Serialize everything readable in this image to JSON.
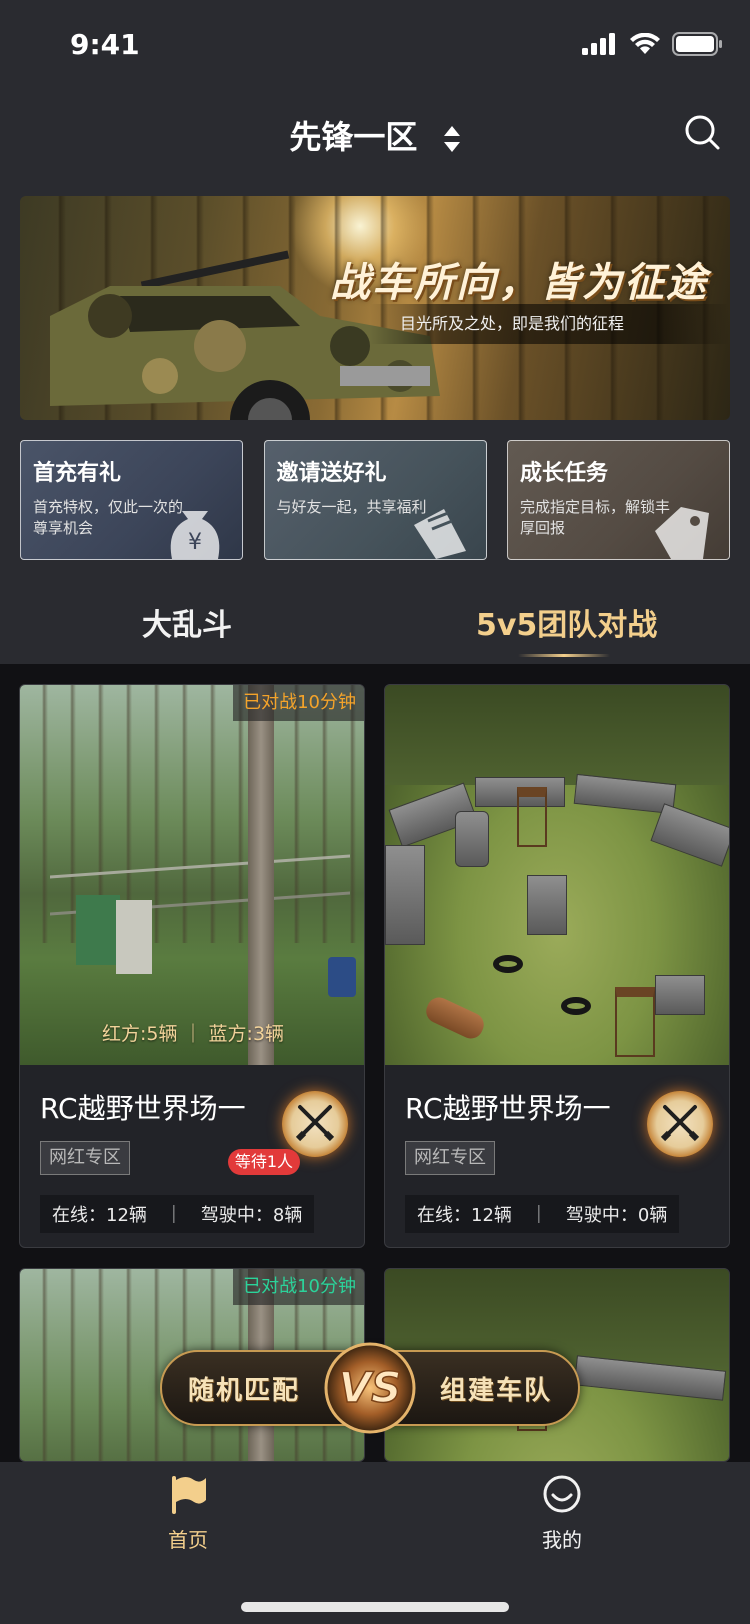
{
  "status_bar": {
    "time": "9:41",
    "icons": [
      "signal-icon",
      "wifi-icon",
      "battery-icon"
    ]
  },
  "header": {
    "region": "先锋一区",
    "sort_icon": "sort-updown-icon",
    "search_icon": "search-icon"
  },
  "banner": {
    "title": "战车所向，皆为征途",
    "subtitle": "目光所及之处，即是我们的征程"
  },
  "promos": [
    {
      "title": "首充有礼",
      "desc": "首充特权，仅此一次的尊享机会",
      "icon": "money-bag-icon"
    },
    {
      "title": "邀请送好礼",
      "desc": "与好友一起，共享福利",
      "icon": "gift-ticket-icon"
    },
    {
      "title": "成长任务",
      "desc": "完成指定目标，解锁丰厚回报",
      "icon": "task-tag-icon"
    }
  ],
  "tabs": {
    "melee": "大乱斗",
    "team": "5v5团队对战",
    "active": "team"
  },
  "rooms": [
    {
      "title": "RC越野世界场一",
      "tag": "网红专区",
      "badge_time": "已对战10分钟",
      "teams": "红方:5辆 ｜ 蓝方:3辆",
      "wait": "等待1人",
      "online_label": "在线：12辆",
      "driving_label": "驾驶中：8辆",
      "sep": "｜"
    },
    {
      "title": "RC越野世界场一",
      "tag": "网红专区",
      "online_label": "在线：12辆",
      "driving_label": "驾驶中：0辆",
      "sep": "｜"
    },
    {
      "badge_time": "已对战10分钟"
    }
  ],
  "match": {
    "random": "随机匹配",
    "vs": "VS",
    "build_team": "组建车队"
  },
  "tabbar": {
    "home": "首页",
    "mine": "我的"
  },
  "colors": {
    "accent": "#f3cf8c",
    "bg": "#2a2b30",
    "content_bg": "#111114",
    "badge_orange": "#f4a32a",
    "badge_green": "#2bd39a",
    "wait_red": "#e23a3a"
  }
}
